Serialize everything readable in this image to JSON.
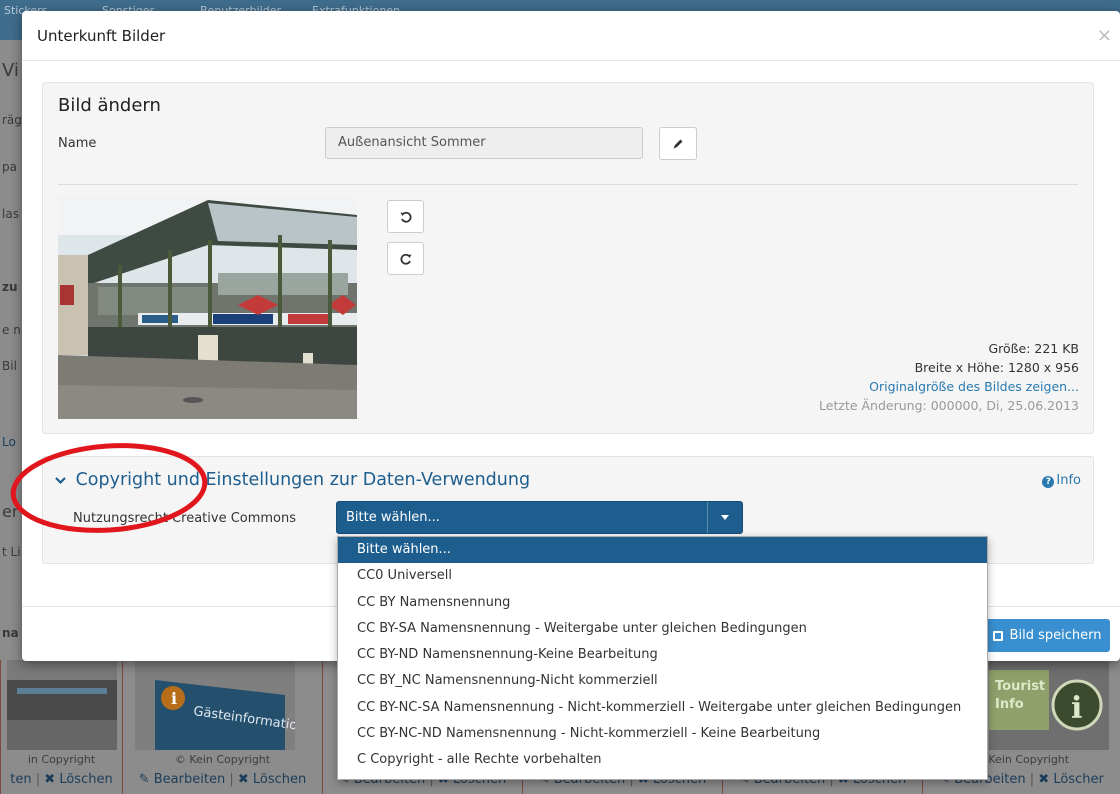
{
  "background": {
    "topbar_items": [
      "Stickers",
      "Sonstiges",
      "Benutzerbilder",
      "Extrafunktionen"
    ],
    "left_fragments": [
      "Vi",
      "räge",
      "pa",
      "las",
      "zu",
      "e n",
      "Bil",
      "Lo",
      "er",
      "t Li",
      "na"
    ],
    "tiles": [
      {
        "copyright": "in Copyright",
        "edit": "ten",
        "delete": "Löschen"
      },
      {
        "copyright": "© Kein Copyright",
        "edit": "Bearbeiten",
        "delete": "Löschen"
      },
      {
        "copyright": "",
        "edit": "Bearbeiten",
        "delete": "Löschen"
      },
      {
        "copyright": "",
        "edit": "Bearbeiten",
        "delete": "Löschen"
      },
      {
        "copyright": "",
        "edit": "Bearbeiten",
        "delete": "Löschen"
      },
      {
        "copyright": "© Kein Copyright",
        "edit": "Bearbeiten",
        "delete": "Löscher"
      }
    ],
    "tile_signs": {
      "tile2": "Gästeinformation",
      "tile6_a": "Tourist",
      "tile6_b": "Info"
    }
  },
  "modal": {
    "title": "Unterkunft Bilder",
    "close": "×",
    "edit_panel": {
      "title": "Bild ändern",
      "name_label": "Name",
      "name_value": "Außenansicht Sommer",
      "size": "Größe: 221 KB",
      "dimensions": "Breite x Höhe: 1280 x 956",
      "original_link": "Originalgröße des Bildes zeigen...",
      "last_change": "Letzte Änderung: 000000, Di, 25.06.2013"
    },
    "copyright_panel": {
      "title": "Copyright und Einstellungen zur Daten-Verwendung",
      "info_link": "Info",
      "cc_label": "Nutzungsrecht Creative Commons",
      "select_value": "Bitte wählen..."
    },
    "save_button": "Bild speichern"
  },
  "dropdown": {
    "options": [
      "Bitte wählen...",
      "CC0 Universell",
      "CC BY Namensnennung",
      "CC BY-SA Namensnennung - Weitergabe unter gleichen Bedingungen",
      "CC BY-ND Namensnennung-Keine Bearbeitung",
      "CC BY_NC Namensnennung-Nicht kommerziell",
      "CC BY-NC-SA Namensnennung - Nicht-kommerziell - Weitergabe unter gleichen Bedingungen",
      "CC BY-NC-ND Namensnennung - Nicht-kommerziell - Keine Bearbeitung",
      "C Copyright - alle Rechte vorbehalten"
    ],
    "selected_index": 0
  },
  "icons": {
    "edit": "pencil-icon",
    "rotate_left": "rotate-left-icon",
    "rotate_right": "rotate-right-icon",
    "chevron": "chevron-down-icon",
    "info": "question-circle-icon",
    "save": "floppy-disk-icon"
  },
  "colors": {
    "primary": "#1d5e8e",
    "link": "#2a7ab0",
    "save_button": "#3a8fd0",
    "annotation": "#e0161c"
  }
}
